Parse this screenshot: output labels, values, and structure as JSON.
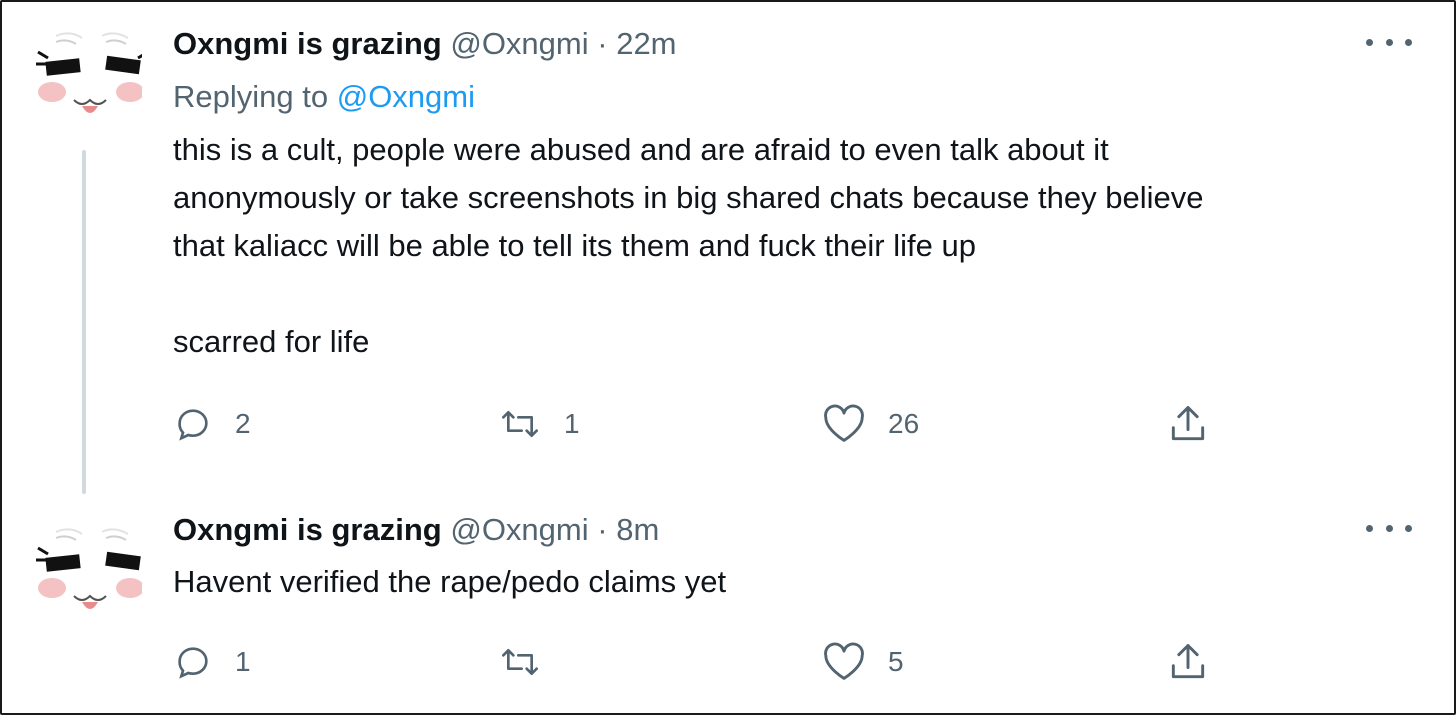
{
  "tweets": [
    {
      "display_name": "Oxngmi is grazing",
      "handle": "@Oxngmi",
      "separator": "·",
      "time": "22m",
      "replying_label": "Replying to",
      "replying_handle": "@Oxngmi",
      "text_lines": [
        "this is a cult, people were abused and are afraid to even talk about it",
        "anonymously or take screenshots in big shared chats because they believe",
        "that kaliacc will be able to tell its them and fuck their life up",
        "scarred for life"
      ],
      "replies": "2",
      "retweets": "1",
      "likes": "26"
    },
    {
      "display_name": "Oxngmi is grazing",
      "handle": "@Oxngmi",
      "separator": "·",
      "time": "8m",
      "text_lines": [
        "Havent verified the rape/pedo claims yet"
      ],
      "replies": "1",
      "retweets": "",
      "likes": "5"
    }
  ],
  "icons": {
    "avatar": "cat-face-avatar-icon",
    "more": "more-options-icon",
    "reply": "reply-bubble-icon",
    "retweet": "retweet-icon",
    "like": "heart-icon",
    "share": "share-icon"
  },
  "colors": {
    "text": "#0f1419",
    "muted": "#536471",
    "link": "#1d9bf0",
    "thread_line": "#cfd9de"
  }
}
